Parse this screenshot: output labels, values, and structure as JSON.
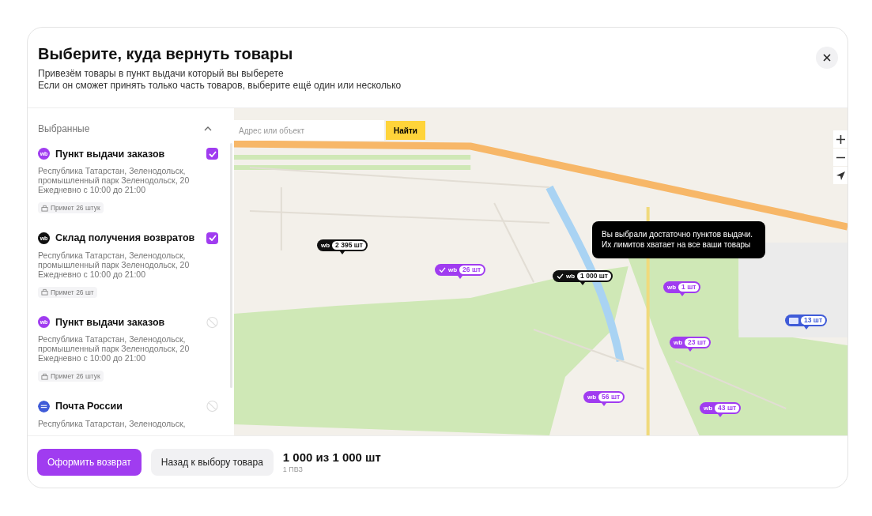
{
  "dialog": {
    "title": "Выберите, куда вернуть товары",
    "subtitle_lines": [
      "Привезём товары в пункт выдачи который вы выберете",
      "Если он сможет принять только часть товаров, выберите ещё один или несколько"
    ]
  },
  "sidebar": {
    "section_title": "Выбранные",
    "expanded": true,
    "items": [
      {
        "logo": "wb",
        "color": "#a03cf0",
        "name": "Пункт выдачи заказов",
        "address_lines": [
          "Республика Татарстан, Зеленодольск,",
          "промышленный парк Зеленодольск, 20"
        ],
        "hours": "Ежедневно с 10:00 до 21:00",
        "capacity": "Примет 26 штук",
        "checked": true,
        "disabled": false
      },
      {
        "logo": "wb",
        "color": "#111111",
        "name": "Склад получения возвратов",
        "address_lines": [
          "Республика Татарстан, Зеленодольск,",
          "промышленный парк Зеленодольск, 20"
        ],
        "hours": "Ежедневно с 10:00 до 21:00",
        "capacity": "Примет 26 шт",
        "checked": true,
        "disabled": false
      },
      {
        "logo": "wb",
        "color": "#a03cf0",
        "name": "Пункт выдачи заказов",
        "address_lines": [
          "Республика Татарстан, Зеленодольск,",
          "промышленный парк Зеленодольск, 20"
        ],
        "hours": "Ежедневно с 10:00 до 21:00",
        "capacity": "Примет 26 штук",
        "checked": false,
        "disabled": true
      },
      {
        "color": "#3f5bd8",
        "name": "Почта России",
        "address_lines": [
          "Республика Татарстан, Зеленодольск,"
        ],
        "checked": false,
        "disabled": true
      }
    ]
  },
  "map": {
    "search": {
      "placeholder": "Адрес или объект",
      "button": "Найти"
    },
    "tooltip": "Вы выбрали достаточно пунктов выдачи. Их лимитов хватает на все ваши товары",
    "markers": [
      {
        "kind": "dark",
        "logo": "wb",
        "count": "2 395 шт",
        "checked": false
      },
      {
        "kind": "purple",
        "logo": "wb",
        "count": "26 шт",
        "checked": true
      },
      {
        "kind": "dark",
        "logo": "wb",
        "count": "1 000 шт",
        "checked": true
      },
      {
        "kind": "purple",
        "logo": "wb",
        "count": "1 шт",
        "checked": false
      },
      {
        "kind": "post",
        "count": "13 шт",
        "checked": false
      },
      {
        "kind": "purple",
        "logo": "wb",
        "count": "23 шт",
        "checked": false
      },
      {
        "kind": "purple",
        "logo": "wb",
        "count": "56 шт",
        "checked": false
      },
      {
        "kind": "purple",
        "logo": "wb",
        "count": "43 шт",
        "checked": false
      }
    ]
  },
  "footer": {
    "primary_button": "Оформить возврат",
    "secondary_button": "Назад к выбору товара",
    "total": "1 000 из 1 000 шт",
    "points": "1 ПВЗ"
  }
}
